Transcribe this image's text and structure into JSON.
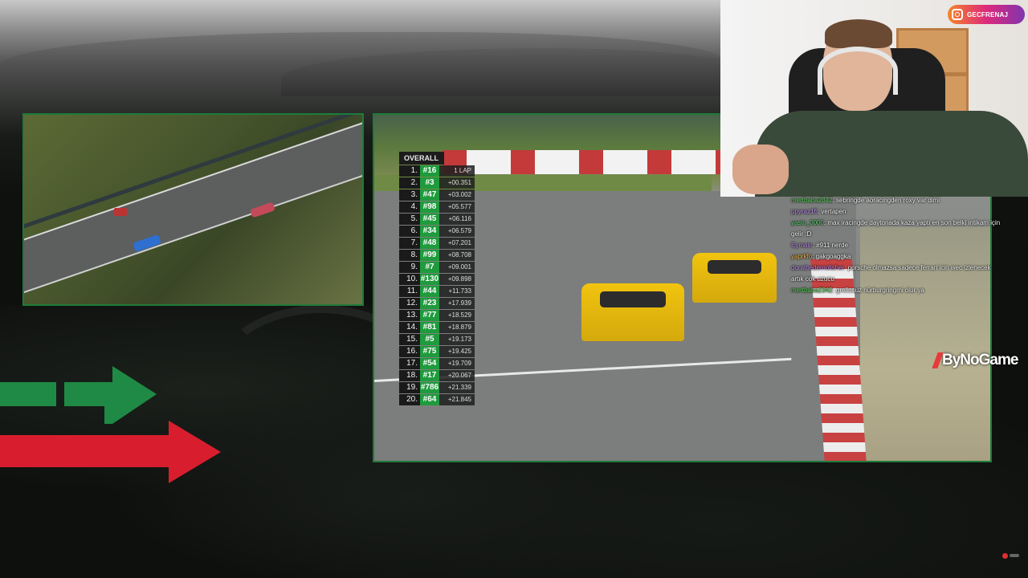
{
  "instagram": {
    "handle": "GECFRENAJ"
  },
  "leaderboard": {
    "header": "OVERALL",
    "rows": [
      {
        "pos": "1.",
        "num": "#16",
        "gap": "1 LAP"
      },
      {
        "pos": "2.",
        "num": "#3",
        "gap": "+00.351"
      },
      {
        "pos": "3.",
        "num": "#47",
        "gap": "+03.002"
      },
      {
        "pos": "4.",
        "num": "#98",
        "gap": "+05.577"
      },
      {
        "pos": "5.",
        "num": "#45",
        "gap": "+06.116"
      },
      {
        "pos": "6.",
        "num": "#34",
        "gap": "+06.579"
      },
      {
        "pos": "7.",
        "num": "#48",
        "gap": "+07.201"
      },
      {
        "pos": "8.",
        "num": "#99",
        "gap": "+08.708"
      },
      {
        "pos": "9.",
        "num": "#7",
        "gap": "+09.001"
      },
      {
        "pos": "10.",
        "num": "#130",
        "gap": "+09.898"
      },
      {
        "pos": "11.",
        "num": "#44",
        "gap": "+11.733"
      },
      {
        "pos": "12.",
        "num": "#23",
        "gap": "+17.939"
      },
      {
        "pos": "13.",
        "num": "#77",
        "gap": "+18.529"
      },
      {
        "pos": "14.",
        "num": "#81",
        "gap": "+18.879"
      },
      {
        "pos": "15.",
        "num": "#5",
        "gap": "+19.173"
      },
      {
        "pos": "16.",
        "num": "#75",
        "gap": "+19.425"
      },
      {
        "pos": "17.",
        "num": "#54",
        "gap": "+19.709"
      },
      {
        "pos": "18.",
        "num": "#17",
        "gap": "+20.067"
      },
      {
        "pos": "19.",
        "num": "#786",
        "gap": "+21.339"
      },
      {
        "pos": "20.",
        "num": "#64",
        "gap": "+21.845"
      }
    ]
  },
  "chat": {
    "messages": [
      {
        "user": "mertbaba2342",
        "color": "#56d356",
        "text": ": sebringde aoracingden roxy var dimi"
      },
      {
        "user": "ppyraz15",
        "color": "#b98be8",
        "text": ": vertapen"
      },
      {
        "user": "yasin_0000",
        "color": "#4fd16a",
        "text": ": max iracingde daytonada kaza yaptı en son belki intikam için gelir :D"
      },
      {
        "user": "Eymain",
        "color": "#b98be8",
        "text": ": #911 nerde"
      },
      {
        "user": "yaprkfo",
        "color": "#e8b14a",
        "text": ": gakgoaggka"
      },
      {
        "user": "dorathedemolisher",
        "color": "#b98be8",
        "text": ": porsche olmazsa sadece ferrari icin wec izlenecek artık cok uzucu"
      },
      {
        "user": "mertbaba2342",
        "color": "#56d356",
        "text": ": grellosuz nürburgringmi olur ya"
      }
    ]
  },
  "watermark": {
    "text": "ByNoGame"
  },
  "colors": {
    "frame": "#1f7a3a",
    "pos_green": "#1f9b3d",
    "arrow_green": "#1f8a45",
    "arrow_red": "#d81e2e"
  }
}
